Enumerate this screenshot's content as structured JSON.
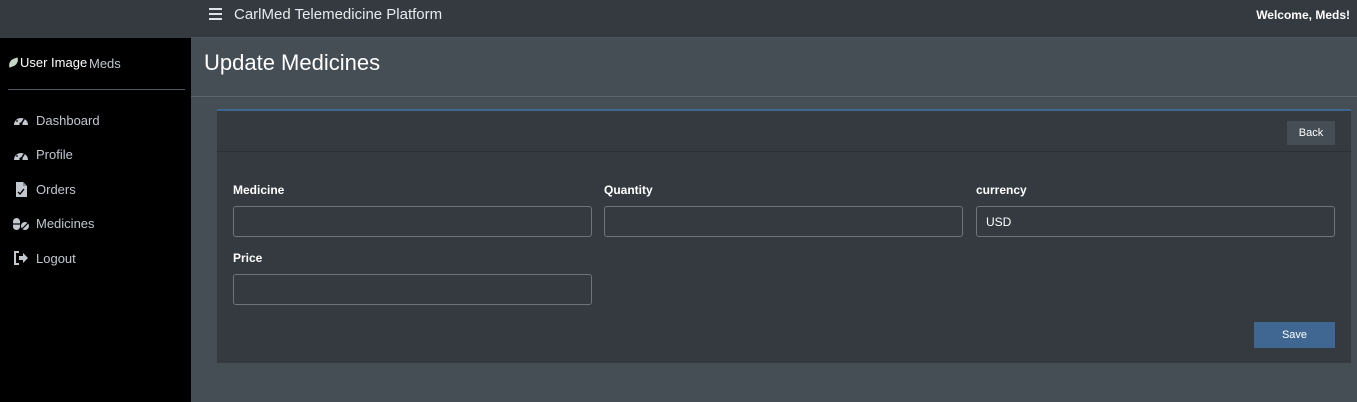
{
  "header": {
    "app_title": "CarlMed Telemedicine Platform",
    "welcome": "Welcome, Meds!",
    "menu_icon": "hamburger-icon"
  },
  "sidebar": {
    "user_image_alt": "User Image",
    "user_name": "Meds",
    "items": [
      {
        "label": "Dashboard",
        "icon": "speedometer-icon"
      },
      {
        "label": "Profile",
        "icon": "speedometer-icon"
      },
      {
        "label": "Orders",
        "icon": "document-icon"
      },
      {
        "label": "Medicines",
        "icon": "pills-icon"
      },
      {
        "label": "Logout",
        "icon": "sign-out-icon"
      }
    ]
  },
  "page": {
    "title": "Update Medicines"
  },
  "card": {
    "back_label": "Back",
    "save_label": "Save",
    "fields": {
      "medicine": {
        "label": "Medicine",
        "value": ""
      },
      "quantity": {
        "label": "Quantity",
        "value": ""
      },
      "currency": {
        "label": "currency",
        "value": "USD"
      },
      "price": {
        "label": "Price",
        "value": ""
      }
    }
  },
  "colors": {
    "sidebar_bg": "#000000",
    "topbar_bg": "#343a40",
    "content_bg": "#454d55",
    "card_bg": "#343a40",
    "primary": "#3f6791"
  }
}
